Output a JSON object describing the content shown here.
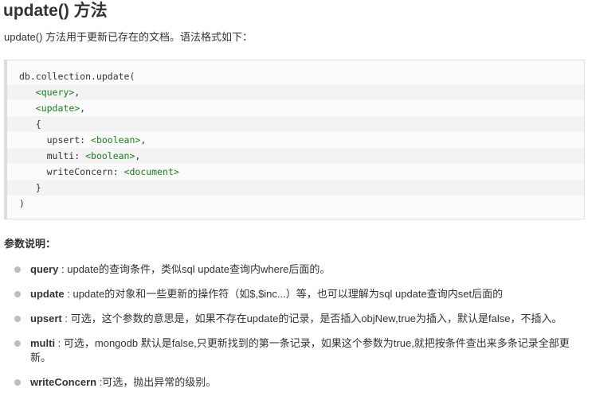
{
  "title": "update() 方法",
  "intro": "update() 方法用于更新已存在的文档。语法格式如下：",
  "code": [
    {
      "pre": "db.collection.update(",
      "tag": "",
      "post": ""
    },
    {
      "pre": "   ",
      "tag": "<query>",
      "post": ","
    },
    {
      "pre": "   ",
      "tag": "<update>",
      "post": ","
    },
    {
      "pre": "   {",
      "tag": "",
      "post": ""
    },
    {
      "pre": "     upsert: ",
      "tag": "<boolean>",
      "post": ","
    },
    {
      "pre": "     multi: ",
      "tag": "<boolean>",
      "post": ","
    },
    {
      "pre": "     writeConcern: ",
      "tag": "<document>",
      "post": ""
    },
    {
      "pre": "   }",
      "tag": "",
      "post": ""
    },
    {
      "pre": ")",
      "tag": "",
      "post": ""
    }
  ],
  "params_title": "参数说明：",
  "params": [
    {
      "name": "query",
      "desc": " : update的查询条件，类似sql update查询内where后面的。"
    },
    {
      "name": "update",
      "desc": " : update的对象和一些更新的操作符（如$,$inc...）等，也可以理解为sql update查询内set后面的"
    },
    {
      "name": "upsert",
      "desc": " : 可选，这个参数的意思是，如果不存在update的记录，是否插入objNew,true为插入，默认是false，不插入。"
    },
    {
      "name": "multi",
      "desc": " : 可选，mongodb 默认是false,只更新找到的第一条记录，如果这个参数为true,就把按条件查出来多条记录全部更新。"
    },
    {
      "name": "writeConcern",
      "desc": " :可选，抛出异常的级别。"
    }
  ]
}
